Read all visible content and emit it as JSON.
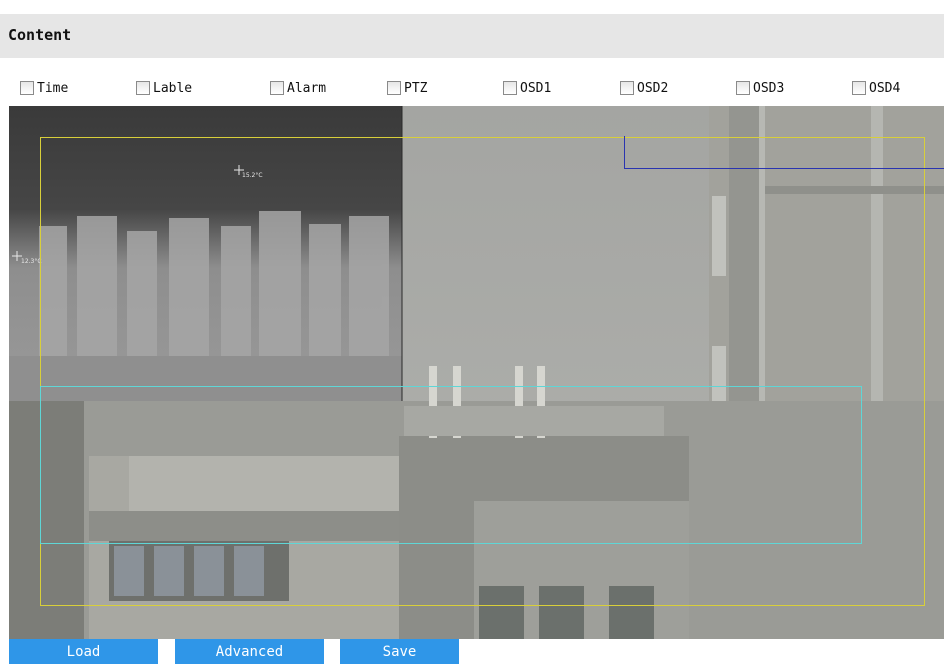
{
  "header": {
    "title": "Content"
  },
  "checkboxes": [
    {
      "label": "Time",
      "checked": false
    },
    {
      "label": "Lable",
      "checked": false
    },
    {
      "label": "Alarm",
      "checked": false
    },
    {
      "label": "PTZ",
      "checked": false
    },
    {
      "label": "OSD1",
      "checked": false
    },
    {
      "label": "OSD2",
      "checked": false
    },
    {
      "label": "OSD3",
      "checked": false
    },
    {
      "label": "OSD4",
      "checked": false
    }
  ],
  "video": {
    "temp_markers": [
      "15.2°C",
      "12.3°C"
    ],
    "overlay_colors": {
      "yellow": "#d8cf3a",
      "cyan": "#5fd6d6",
      "blue": "#2a34b0"
    }
  },
  "buttons": {
    "load": "Load",
    "advanced": "Advanced",
    "save": "Save"
  }
}
